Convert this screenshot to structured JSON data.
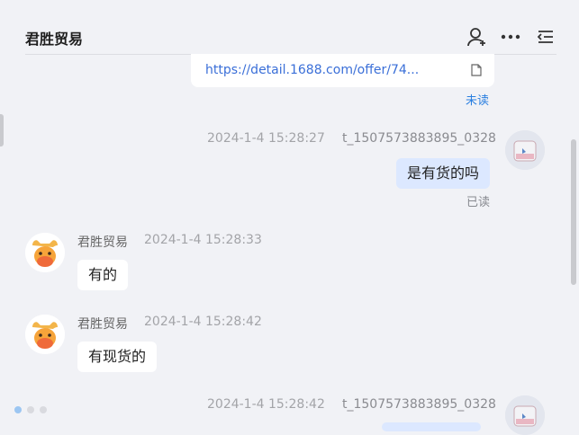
{
  "header": {
    "title": "君胜贸易"
  },
  "messages": [
    {
      "kind": "link",
      "url": "https://detail.1688.com/offer/74...",
      "status": "未读"
    },
    {
      "kind": "out",
      "time": "2024-1-4 15:28:27",
      "sender": "t_1507573883895_0328",
      "text": "是有货的吗",
      "status": "已读"
    },
    {
      "kind": "in",
      "sender": "君胜贸易",
      "time": "2024-1-4 15:28:33",
      "text": "有的"
    },
    {
      "kind": "in",
      "sender": "君胜贸易",
      "time": "2024-1-4 15:28:42",
      "text": "有现货的"
    },
    {
      "kind": "out",
      "time": "2024-1-4 15:28:42",
      "sender": "t_1507573883895_0328"
    }
  ],
  "colors": {
    "link": "#3a6fd8",
    "unread": "#2a7fe0",
    "outgoing_bubble": "#dce8ff",
    "background": "#f1f2f6"
  },
  "icons": {
    "add_contact": "user-plus-icon",
    "more": "more-horizontal-icon",
    "menu": "menu-list-icon",
    "doc": "document-icon"
  }
}
